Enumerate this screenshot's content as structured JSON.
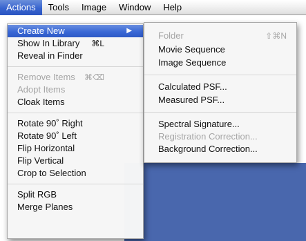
{
  "menubar": {
    "items": [
      "Actions",
      "Tools",
      "Image",
      "Window",
      "Help"
    ]
  },
  "actions_menu": {
    "create_new": "Create New",
    "show_in_library": "Show In Library",
    "show_in_library_shortcut": "⌘L",
    "reveal_in_finder": "Reveal in Finder",
    "remove_items": "Remove Items",
    "remove_items_shortcut": "⌘⌫",
    "adopt_items": "Adopt Items",
    "cloak_items": "Cloak Items",
    "rotate_right": "Rotate 90˚ Right",
    "rotate_left": "Rotate 90˚ Left",
    "flip_horizontal": "Flip Horizontal",
    "flip_vertical": "Flip Vertical",
    "crop_to_selection": "Crop to Selection",
    "split_rgb": "Split RGB",
    "merge_planes": "Merge Planes"
  },
  "create_new_submenu": {
    "folder": "Folder",
    "folder_shortcut": "⇧⌘N",
    "movie_sequence": "Movie Sequence",
    "image_sequence": "Image Sequence",
    "calculated_psf": "Calculated PSF...",
    "measured_psf": "Measured PSF...",
    "spectral_signature": "Spectral Signature...",
    "registration_correction": "Registration Correction...",
    "background_correction": "Background Correction..."
  },
  "icons": {
    "submenu_arrow": "chevron-right-icon"
  },
  "colors": {
    "highlight": "#3a68d6",
    "background_window": "#4967ad",
    "disabled_text": "#a6a6a6"
  }
}
